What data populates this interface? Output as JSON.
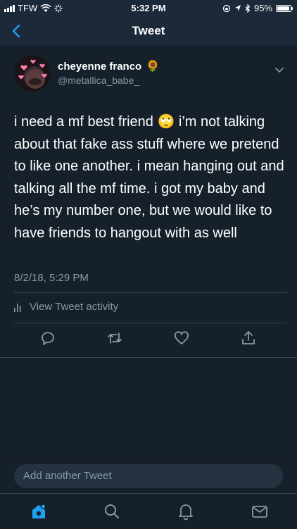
{
  "status_bar": {
    "carrier": "TFW",
    "time": "5:32 PM",
    "battery_text": "95%",
    "battery_level": 0.95
  },
  "nav": {
    "title": "Tweet",
    "back_icon": "chevron-left-icon"
  },
  "tweet": {
    "author_name": "cheyenne franco",
    "author_emoji": "🌻",
    "author_handle": "@metallica_babe_",
    "text": "i need a mf best friend 🙄 i’m not talking about that fake ass stuff where we pretend to like one another. i mean hanging out and talking all the mf time. i got my baby and he’s my number one, but we would like to have friends to hangout with as well",
    "timestamp": "8/2/18, 5:29 PM",
    "activity_label": "View Tweet activity",
    "actions": [
      "reply-icon",
      "retweet-icon",
      "like-icon",
      "share-icon"
    ]
  },
  "compose": {
    "placeholder": "Add another Tweet"
  },
  "tab_bar": {
    "items": [
      "home-icon",
      "search-icon",
      "notifications-icon",
      "messages-icon"
    ],
    "active": "home-icon"
  },
  "colors": {
    "background": "#15202b",
    "header": "#1c2938",
    "accent": "#1da1f2",
    "secondary_text": "#8899a6",
    "divider": "#38444d"
  }
}
